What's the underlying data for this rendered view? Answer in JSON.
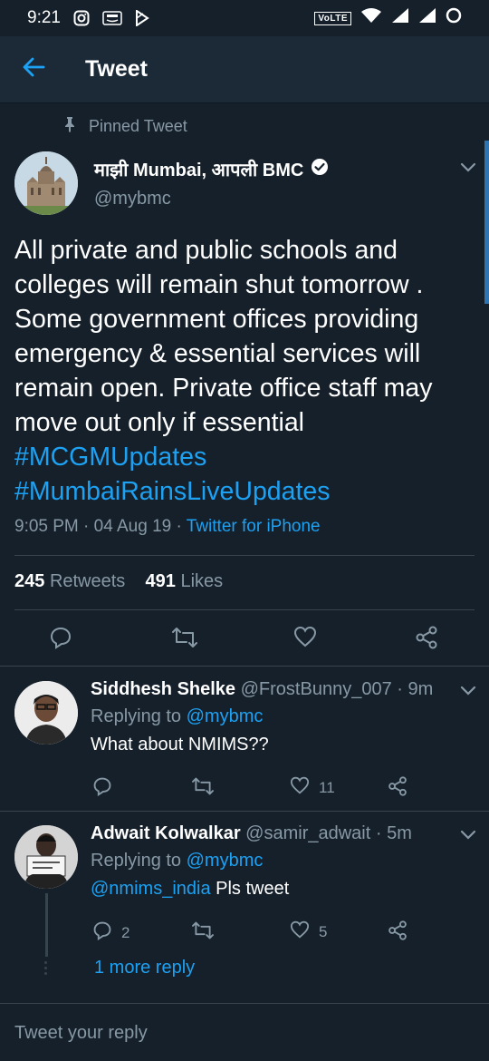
{
  "status_bar": {
    "time": "9:21",
    "network_badge": "VoLTE",
    "icons": [
      "instagram-icon",
      "amazon-icon",
      "play-store-icon",
      "wifi-icon",
      "signal-icon",
      "signal-icon",
      "dnd-icon"
    ]
  },
  "header": {
    "title": "Tweet",
    "back_icon": "arrow-left-icon"
  },
  "tweet": {
    "pinned_label": "Pinned Tweet",
    "author_name": "माझी Mumbai, आपली BMC",
    "handle": "@mybmc",
    "verified": true,
    "text": "All private and public schools and colleges will remain shut tomorrow . Some government offices providing emergency & essential services will remain open. Private office staff may move out only if essential",
    "hashtag1": "#MCGMUpdates",
    "hashtag2": "#MumbaiRainsLiveUpdates",
    "timestamp": "9:05 PM · 04 Aug 19 · ",
    "source": "Twitter for iPhone",
    "retweets_count": "245",
    "retweets_label": "Retweets",
    "likes_count": "491",
    "likes_label": "Likes"
  },
  "replies": [
    {
      "name": "Siddhesh Shelke",
      "handle": "@FrostBunny_007 · 9m",
      "replying_prefix": "Replying to ",
      "replying_to": "@mybmc",
      "text": "What about NMIMS??",
      "reply_count": "",
      "like_count": "11"
    },
    {
      "name": "Adwait Kolwalkar",
      "handle": "@samir_adwait · 5m",
      "replying_prefix": "Replying to ",
      "replying_to": "@mybmc",
      "mention": "@nmims_india",
      "text": " Pls tweet",
      "reply_count": "2",
      "like_count": "5",
      "more_replies": "1 more reply"
    }
  ],
  "composer": {
    "placeholder": "Tweet your reply"
  },
  "colors": {
    "background": "#15202b",
    "accent": "#1da1f2",
    "secondary_text": "#8899a6",
    "divider": "#38444d"
  }
}
